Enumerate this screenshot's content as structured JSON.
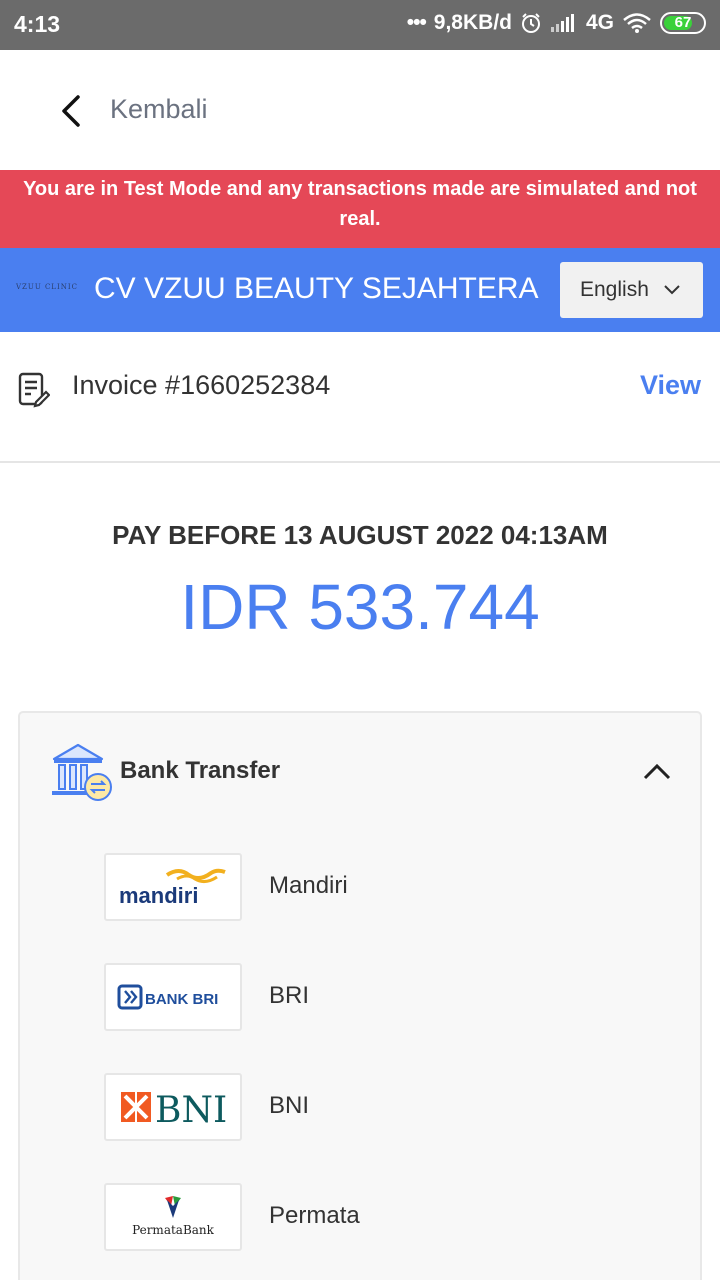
{
  "status_bar": {
    "time": "4:13",
    "network_speed": "9,8KB/d",
    "network_type": "4G",
    "battery": "67",
    "icons": [
      "alarm-icon",
      "signal-icon",
      "wifi-icon",
      "battery-icon"
    ]
  },
  "nav": {
    "back_label": "Kembali"
  },
  "banner": {
    "text": "You are in Test Mode and any transactions made are simulated and not real."
  },
  "merchant": {
    "logo_text": "VZUU CLINIC",
    "name": "CV VZUU BEAUTY SEJAHTERA",
    "language": "English"
  },
  "invoice": {
    "label": "Invoice #1660252384",
    "view_label": "View"
  },
  "payment": {
    "pay_before": "PAY BEFORE 13 AUGUST 2022 04:13AM",
    "amount": "IDR 533.744"
  },
  "bank_transfer": {
    "title": "Bank Transfer",
    "banks": [
      {
        "name": "Mandiri",
        "logo_text": "mandiri"
      },
      {
        "name": "BRI",
        "logo_text": "BANK BRI"
      },
      {
        "name": "BNI",
        "logo_text": "BNI"
      },
      {
        "name": "Permata",
        "logo_text": "PermataBank"
      }
    ]
  },
  "colors": {
    "status_bar": "#6b6b6b",
    "test_banner": "#e54857",
    "primary_blue": "#4a7ff0",
    "card_bg": "#f8f8f8"
  }
}
